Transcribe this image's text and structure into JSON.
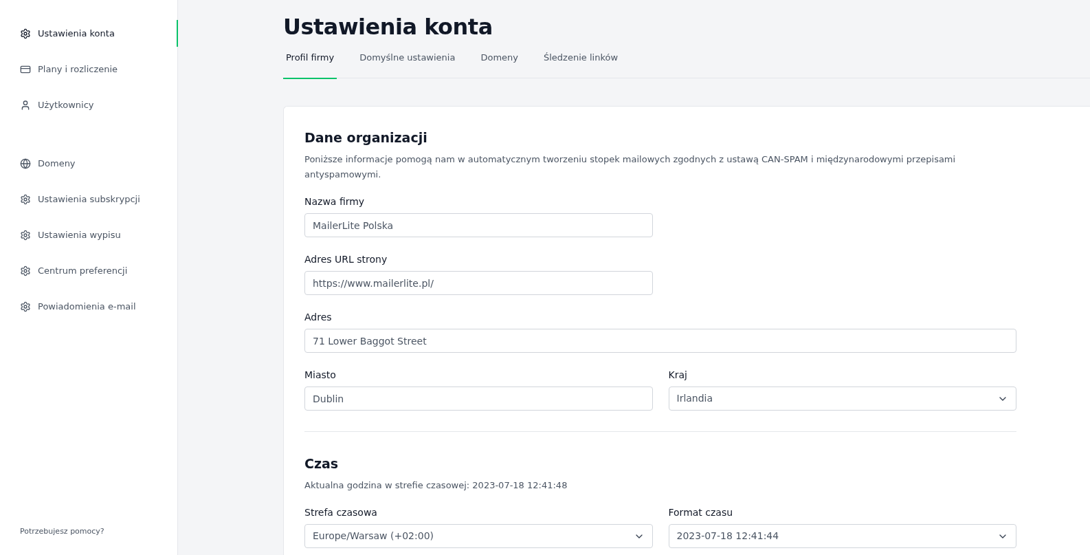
{
  "sidebar": {
    "groups": [
      [
        {
          "label": "Ustawienia konta",
          "kind": "gear",
          "selected": true
        },
        {
          "label": "Plany i rozliczenie",
          "kind": "card",
          "selected": false
        },
        {
          "label": "Użytkownicy",
          "kind": "user",
          "selected": false
        }
      ],
      [
        {
          "label": "Domeny",
          "kind": "globe",
          "selected": false
        },
        {
          "label": "Ustawienia subskrypcji",
          "kind": "gear",
          "selected": false
        },
        {
          "label": "Ustawienia wypisu",
          "kind": "gear",
          "selected": false
        },
        {
          "label": "Centrum preferencji",
          "kind": "gear",
          "selected": false
        },
        {
          "label": "Powiadomienia e-mail",
          "kind": "gear",
          "selected": false
        }
      ]
    ],
    "help_link": "Potrzebujesz pomocy?"
  },
  "page_title": "Ustawienia konta",
  "tabs": [
    {
      "label": "Profil firmy",
      "selected": true
    },
    {
      "label": "Domyślne ustawienia",
      "selected": false
    },
    {
      "label": "Domeny",
      "selected": false
    },
    {
      "label": "Śledzenie linków",
      "selected": false
    }
  ],
  "sections": [
    {
      "title": "Dane organizacji",
      "description": "Poniższe informacje pomogą nam w automatycznym tworzeniu stopek mailowych zgodnych z ustawą CAN-SPAM i międzynarodowymi przepisami antyspamowymi.",
      "rows": [
        [
          {
            "label": "Nazwa firmy",
            "kind": "text",
            "value": "MailerLite Polska",
            "wide": false
          }
        ],
        [
          {
            "label": "Adres URL strony",
            "kind": "text",
            "value": "https://www.mailerlite.pl/",
            "wide": false
          }
        ],
        [
          {
            "label": "Adres",
            "kind": "text",
            "value": "71 Lower Baggot Street",
            "wide": true
          }
        ],
        [
          {
            "label": "Miasto",
            "kind": "text",
            "value": "Dublin",
            "wide": false
          },
          {
            "label": "Kraj",
            "kind": "select",
            "value": "Irlandia",
            "wide": false
          }
        ]
      ]
    },
    {
      "title": "Czas",
      "description": "Aktualna godzina w strefie czasowej: 2023-07-18 12:41:48",
      "rows": [
        [
          {
            "label": "Strefa czasowa",
            "kind": "select",
            "value": "Europe/Warsaw (+02:00)",
            "wide": false
          },
          {
            "label": "Format czasu",
            "kind": "select",
            "value": "2023-07-18 12:41:44",
            "wide": false
          }
        ]
      ]
    }
  ]
}
